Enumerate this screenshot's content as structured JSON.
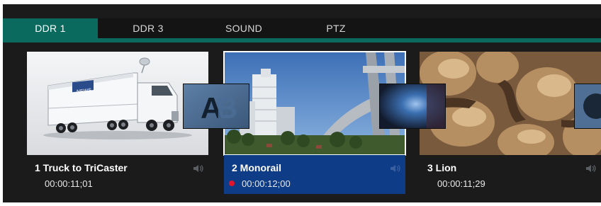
{
  "tabs": [
    {
      "label": "DDR 1",
      "active": true
    },
    {
      "label": "DDR 3",
      "active": false
    },
    {
      "label": "SOUND",
      "active": false
    },
    {
      "label": "PTZ",
      "active": false
    }
  ],
  "clips": [
    {
      "index": "1",
      "name": "Truck to TriCaster",
      "title": "1 Truck to TriCaster",
      "duration": "00:00:11;01",
      "selected": false,
      "recording": false
    },
    {
      "index": "2",
      "name": "Monorail",
      "title": "2 Monorail",
      "duration": "00:00:12;00",
      "selected": true,
      "recording": true
    },
    {
      "index": "3",
      "name": "Lion",
      "title": "3 Lion",
      "duration": "00:00:11;29",
      "selected": false,
      "recording": false
    }
  ],
  "transitions": [
    {
      "icon": "ab-wipe-transition-icon"
    },
    {
      "icon": "light-burst-transition-icon"
    },
    {
      "icon": "partial-transition-icon"
    }
  ],
  "icons": {
    "audio": "audio-speaker-icon",
    "record": "red-record-dot"
  },
  "colors": {
    "tab_active": "#0b6a5e",
    "selected_clip": "#0e3c86",
    "record_dot": "#e0142b",
    "background": "#1b1b1b"
  }
}
